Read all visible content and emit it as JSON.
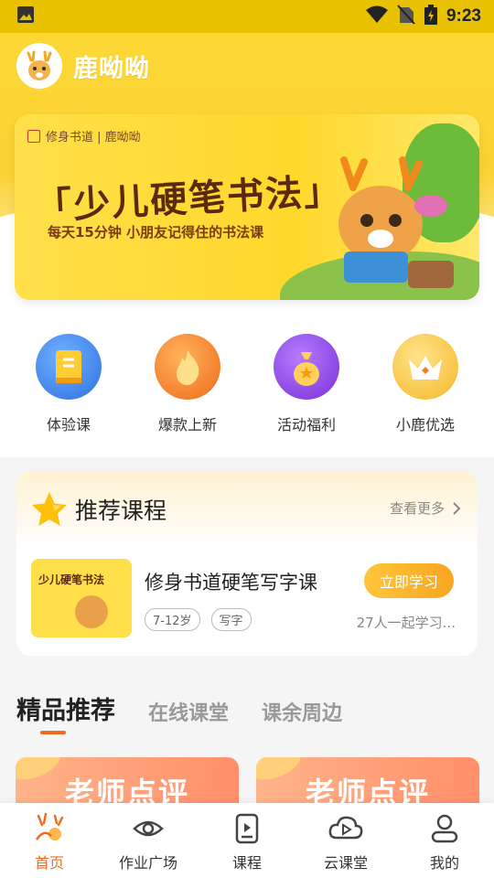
{
  "status_bar": {
    "time": "9:23"
  },
  "app": {
    "logo_text": "鹿呦呦"
  },
  "banner": {
    "brand": "修身书道 | 鹿呦呦",
    "title": "「少儿硬笔书法」",
    "subtitle": "每天15分钟 小朋友记得住的书法课"
  },
  "quick_nav": [
    {
      "label": "体验课",
      "icon": "book-icon",
      "color": "#3a8ef0"
    },
    {
      "label": "爆款上新",
      "icon": "flame-icon",
      "color": "#f57c1f"
    },
    {
      "label": "活动福利",
      "icon": "money-bag-icon",
      "color": "#8a3fe0"
    },
    {
      "label": "小鹿优选",
      "icon": "crown-icon",
      "color": "#f5b72a"
    }
  ],
  "recommend": {
    "title": "推荐课程",
    "more": "查看更多",
    "course": {
      "thumb_title": "少儿硬笔书法",
      "name": "修身书道硬笔写字课",
      "tags": [
        "7-12岁",
        "写字"
      ],
      "button": "立即学习",
      "count": "27人一起学习..."
    }
  },
  "tabs": [
    {
      "label": "精品推荐",
      "active": true
    },
    {
      "label": "在线课堂",
      "active": false
    },
    {
      "label": "课余周边",
      "active": false
    }
  ],
  "cards": [
    {
      "title": "老师点评"
    },
    {
      "title": "老师点评"
    }
  ],
  "bottom_nav": [
    {
      "label": "首页",
      "icon": "home-deer-icon",
      "active": true
    },
    {
      "label": "作业广场",
      "icon": "eye-icon",
      "active": false
    },
    {
      "label": "课程",
      "icon": "play-doc-icon",
      "active": false
    },
    {
      "label": "云课堂",
      "icon": "cloud-play-icon",
      "active": false
    },
    {
      "label": "我的",
      "icon": "user-icon",
      "active": false
    }
  ],
  "colors": {
    "brand_yellow": "#fdd835",
    "accent_orange": "#f06c20"
  }
}
